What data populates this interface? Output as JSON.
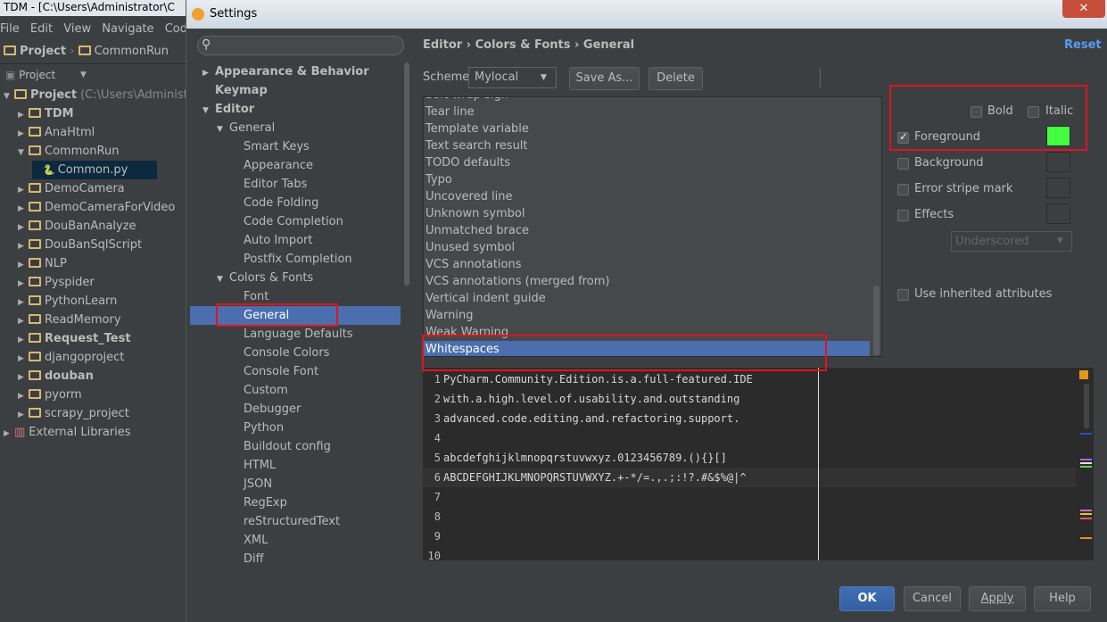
{
  "background": {
    "window_title": "TDM - [C:\\Users\\Administrator\\C",
    "menu": [
      "File",
      "Edit",
      "View",
      "Navigate",
      "Code"
    ],
    "crumbs": [
      "Project",
      "CommonRun"
    ],
    "project_dropdown": "Project",
    "tree": [
      {
        "label": "Project",
        "suffix": "(C:\\Users\\Administrat",
        "bold": true,
        "type": "folder",
        "depth": 0
      },
      {
        "label": "TDM",
        "bold": true,
        "type": "folder",
        "depth": 1
      },
      {
        "label": "AnaHtml",
        "type": "folder",
        "depth": 1
      },
      {
        "label": "CommonRun",
        "type": "folder",
        "depth": 1
      },
      {
        "label": "Common.py",
        "type": "file",
        "depth": 2
      },
      {
        "label": "DemoCamera",
        "type": "folder",
        "depth": 1
      },
      {
        "label": "DemoCameraForVideo",
        "type": "folder",
        "depth": 1
      },
      {
        "label": "DouBanAnalyze",
        "type": "folder",
        "depth": 1
      },
      {
        "label": "DouBanSqlScript",
        "type": "folder",
        "depth": 1
      },
      {
        "label": "NLP",
        "type": "folder",
        "depth": 1
      },
      {
        "label": "Pyspider",
        "type": "folder",
        "depth": 1
      },
      {
        "label": "PythonLearn",
        "type": "folder",
        "depth": 1
      },
      {
        "label": "ReadMemory",
        "type": "folder",
        "depth": 1
      },
      {
        "label": "Request_Test",
        "bold": true,
        "type": "folder",
        "depth": 1
      },
      {
        "label": "djangoproject",
        "type": "folder",
        "depth": 1
      },
      {
        "label": "douban",
        "bold": true,
        "type": "folder",
        "depth": 1
      },
      {
        "label": "pyorm",
        "type": "folder",
        "depth": 1
      },
      {
        "label": "scrapy_project",
        "type": "folder",
        "depth": 1
      },
      {
        "label": "External Libraries",
        "type": "lib",
        "depth": 0
      }
    ]
  },
  "dialog": {
    "title": "Settings",
    "close_glyph": "✕",
    "breadcrumb": "Editor › Colors & Fonts › General",
    "reset_label": "Reset",
    "nav": [
      {
        "label": "Appearance & Behavior",
        "bold": true,
        "arrow": "▶",
        "indent": 0
      },
      {
        "label": "Keymap",
        "bold": true,
        "arrow": "",
        "indent": 0
      },
      {
        "label": "Editor",
        "bold": true,
        "arrow": "▼",
        "indent": 0
      },
      {
        "label": "General",
        "arrow": "▼",
        "indent": 1
      },
      {
        "label": "Smart Keys",
        "indent": 2
      },
      {
        "label": "Appearance",
        "indent": 2
      },
      {
        "label": "Editor Tabs",
        "indent": 2
      },
      {
        "label": "Code Folding",
        "indent": 2
      },
      {
        "label": "Code Completion",
        "indent": 2
      },
      {
        "label": "Auto Import",
        "indent": 2
      },
      {
        "label": "Postfix Completion",
        "indent": 2
      },
      {
        "label": "Colors & Fonts",
        "arrow": "▼",
        "indent": 1
      },
      {
        "label": "Font",
        "indent": 2
      },
      {
        "label": "General",
        "indent": 2,
        "selected": true
      },
      {
        "label": "Language Defaults",
        "indent": 2
      },
      {
        "label": "Console Colors",
        "indent": 2
      },
      {
        "label": "Console Font",
        "indent": 2
      },
      {
        "label": "Custom",
        "indent": 2
      },
      {
        "label": "Debugger",
        "indent": 2
      },
      {
        "label": "Python",
        "indent": 2
      },
      {
        "label": "Buildout config",
        "indent": 2
      },
      {
        "label": "HTML",
        "indent": 2
      },
      {
        "label": "JSON",
        "indent": 2
      },
      {
        "label": "RegExp",
        "indent": 2
      },
      {
        "label": "reStructuredText",
        "indent": 2
      },
      {
        "label": "XML",
        "indent": 2
      },
      {
        "label": "Diff",
        "indent": 2
      }
    ],
    "scheme": {
      "label": "Scheme:",
      "value": "Mylocal",
      "save_as": "Save As...",
      "delete": "Delete"
    },
    "attributes": [
      "Soft wrap sign",
      "Tear line",
      "Template variable",
      "Text search result",
      "TODO defaults",
      "Typo",
      "Uncovered line",
      "Unknown symbol",
      "Unmatched brace",
      "Unused symbol",
      "VCS annotations",
      "VCS annotations (merged from)",
      "Vertical indent guide",
      "Warning",
      "Weak Warning",
      "Whitespaces"
    ],
    "selected_attribute": "Whitespaces",
    "options": {
      "bold": {
        "label": "Bold",
        "checked": false
      },
      "italic": {
        "label": "Italic",
        "checked": false
      },
      "foreground": {
        "label": "Foreground",
        "checked": true,
        "color": "#42ff42"
      },
      "background": {
        "label": "Background",
        "checked": false
      },
      "error_stripe": {
        "label": "Error stripe mark",
        "checked": false
      },
      "effects": {
        "label": "Effects",
        "checked": false
      },
      "effect_type": "Underscored",
      "use_inherited": {
        "label": "Use inherited attributes",
        "checked": false
      }
    },
    "preview_lines": [
      {
        "num": "1",
        "text": "PyCharm.Community.Edition.is.a.full-featured.IDE"
      },
      {
        "num": "2",
        "text": "with.a.high.level.of.usability.and.outstanding"
      },
      {
        "num": "3",
        "text": "advanced.code.editing.and.refactoring.support."
      },
      {
        "num": "4",
        "text": ""
      },
      {
        "num": "5",
        "text": "abcdefghijklmnopqrstuvwxyz.0123456789.(){}[]"
      },
      {
        "num": "6",
        "text": "ABCDEFGHIJKLMNOPQRSTUVWXYZ.+-*/=.,.;:!?.#&$%@|^"
      },
      {
        "num": "7",
        "text": ""
      },
      {
        "num": "8",
        "text": ""
      },
      {
        "num": "9",
        "text": ""
      },
      {
        "num": "10",
        "text": ""
      }
    ],
    "buttons": {
      "ok": "OK",
      "cancel": "Cancel",
      "apply": "Apply",
      "help": "Help"
    }
  },
  "colors": {
    "highlight_box": "#e0141e",
    "selection": "#4b6eaf",
    "foreground_swatch": "#42ff42"
  }
}
